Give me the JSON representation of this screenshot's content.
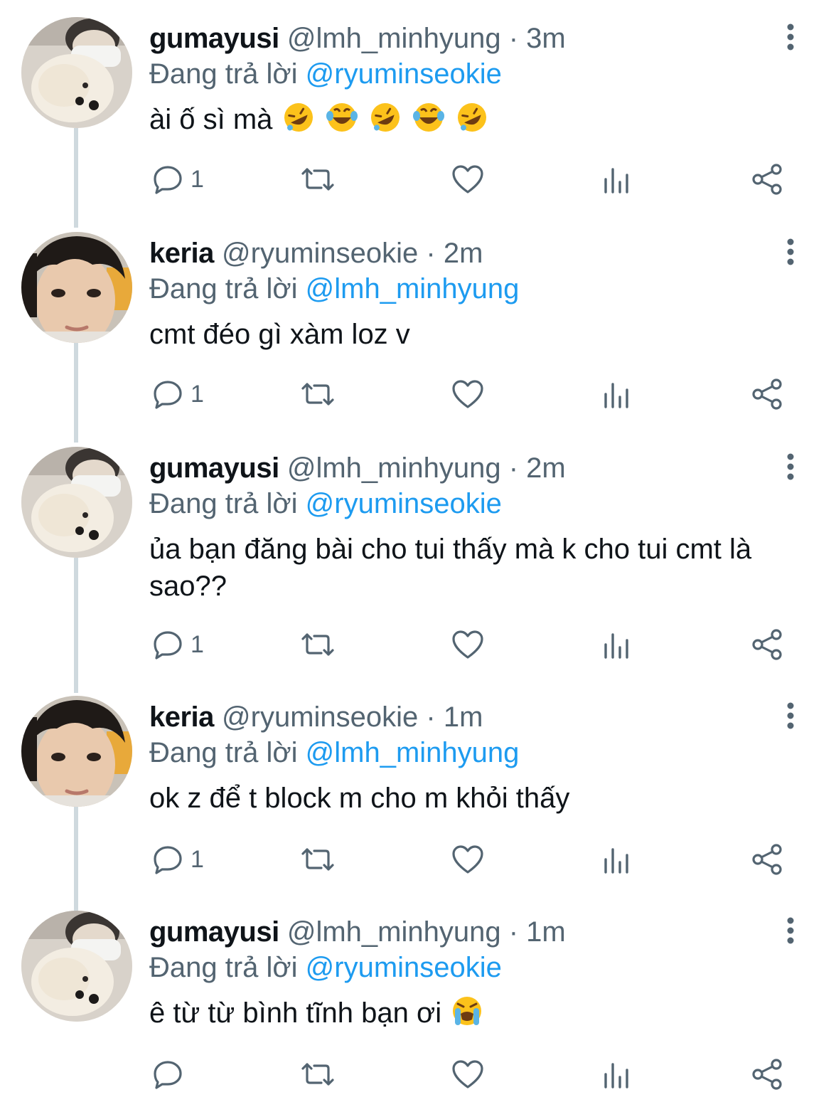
{
  "colors": {
    "text_primary": "#0f1419",
    "text_secondary": "#536471",
    "mention": "#1d9bf0",
    "thread_line": "#cfd9de"
  },
  "reply_prefix": "Đang trả lời",
  "tweets": [
    {
      "display_name": "gumayusi",
      "handle": "@lmh_minhyung",
      "separator": "·",
      "time": "3m",
      "replying_to": "@ryuminseokie",
      "text": "ài ố sì mà",
      "emojis": [
        "rolling-on-floor-laughing",
        "tears-of-joy",
        "rolling-on-floor-laughing",
        "tears-of-joy",
        "rolling-on-floor-laughing"
      ],
      "reply_count": "1",
      "avatar": "dog-avatar"
    },
    {
      "display_name": "keria",
      "handle": "@ryuminseokie",
      "separator": "·",
      "time": "2m",
      "replying_to": "@lmh_minhyung",
      "text": "cmt đéo gì xàm loz v",
      "emojis": [],
      "reply_count": "1",
      "avatar": "face-avatar"
    },
    {
      "display_name": "gumayusi",
      "handle": "@lmh_minhyung",
      "separator": "·",
      "time": "2m",
      "replying_to": "@ryuminseokie",
      "text": "ủa bạn đăng bài cho tui thấy mà k cho tui cmt là sao??",
      "emojis": [],
      "reply_count": "1",
      "avatar": "dog-avatar"
    },
    {
      "display_name": "keria",
      "handle": "@ryuminseokie",
      "separator": "·",
      "time": "1m",
      "replying_to": "@lmh_minhyung",
      "text": "ok z để t block m cho m khỏi thấy",
      "emojis": [],
      "reply_count": "1",
      "avatar": "face-avatar"
    },
    {
      "display_name": "gumayusi",
      "handle": "@lmh_minhyung",
      "separator": "·",
      "time": "1m",
      "replying_to": "@ryuminseokie",
      "text": "ê từ từ bình tĩnh bạn ơi",
      "emojis": [
        "loudly-crying"
      ],
      "reply_count": "",
      "avatar": "dog-avatar"
    }
  ]
}
